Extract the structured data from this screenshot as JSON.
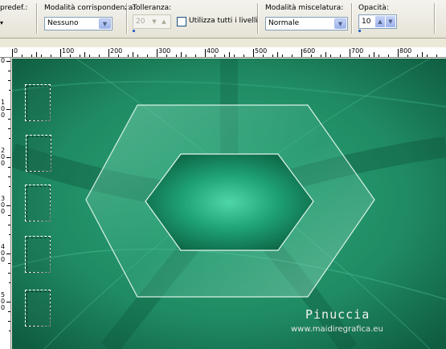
{
  "toolbar": {
    "preset_label": "predef.:",
    "match_mode": {
      "label": "Modalità corrispondenza:",
      "value": "Nessuno"
    },
    "tolerance": {
      "label": "Tolleranza:",
      "value": "20"
    },
    "use_all_layers": {
      "label": "Utilizza tutti i livelli",
      "checked": false
    },
    "blend_mode": {
      "label": "Modalità miscelatura:",
      "value": "Normale"
    },
    "opacity": {
      "label": "Opacità:",
      "value": "10"
    }
  },
  "ruler": {
    "top_labels": [
      "0",
      "100",
      "200",
      "300",
      "400",
      "500",
      "600",
      "700",
      "800"
    ],
    "left_labels": [
      "0",
      "1\n0\n0",
      "2\n0\n0",
      "3\n0\n0",
      "4\n0\n0",
      "5\n0\n0"
    ]
  },
  "watermark": {
    "title": "Pinuccia",
    "url": "www.maidiregrafica.eu"
  },
  "colors": {
    "canvas_base": "#1f8a63",
    "canvas_dark": "#0f5c40",
    "canvas_light": "#4fd6a8",
    "toolbar_bg": "#ece9d8"
  }
}
